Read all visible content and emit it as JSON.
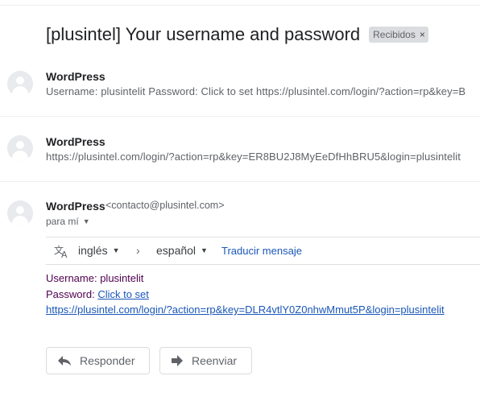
{
  "subject": {
    "title": "[plusintel] Your username and password",
    "label_badge": "Recibidos",
    "remove_label": "×"
  },
  "messages": [
    {
      "sender": "WordPress",
      "snippet": "Username: plusintelit Password: Click to set https://plusintel.com/login/?action=rp&key=B"
    },
    {
      "sender": "WordPress",
      "snippet": "https://plusintel.com/login/?action=rp&key=ER8BU2J8MyEeDfHhBRU5&login=plusintelit"
    }
  ],
  "open_message": {
    "sender": "WordPress",
    "email": "<contacto@plusintel.com>",
    "to": "para mí",
    "translate": {
      "from_lang": "inglés",
      "to_lang": "español",
      "action": "Traducir mensaje"
    },
    "body": {
      "username_label": "Username:",
      "username_value": "plusintelit",
      "password_label": "Password:",
      "password_link": "Click to set",
      "reset_link": "https://plusintel.com/login/?action=rp&key=DLR4vtlY0Z0nhwMmut5P&login=plusintelit"
    }
  },
  "actions": {
    "reply": "Responder",
    "forward": "Reenviar"
  }
}
